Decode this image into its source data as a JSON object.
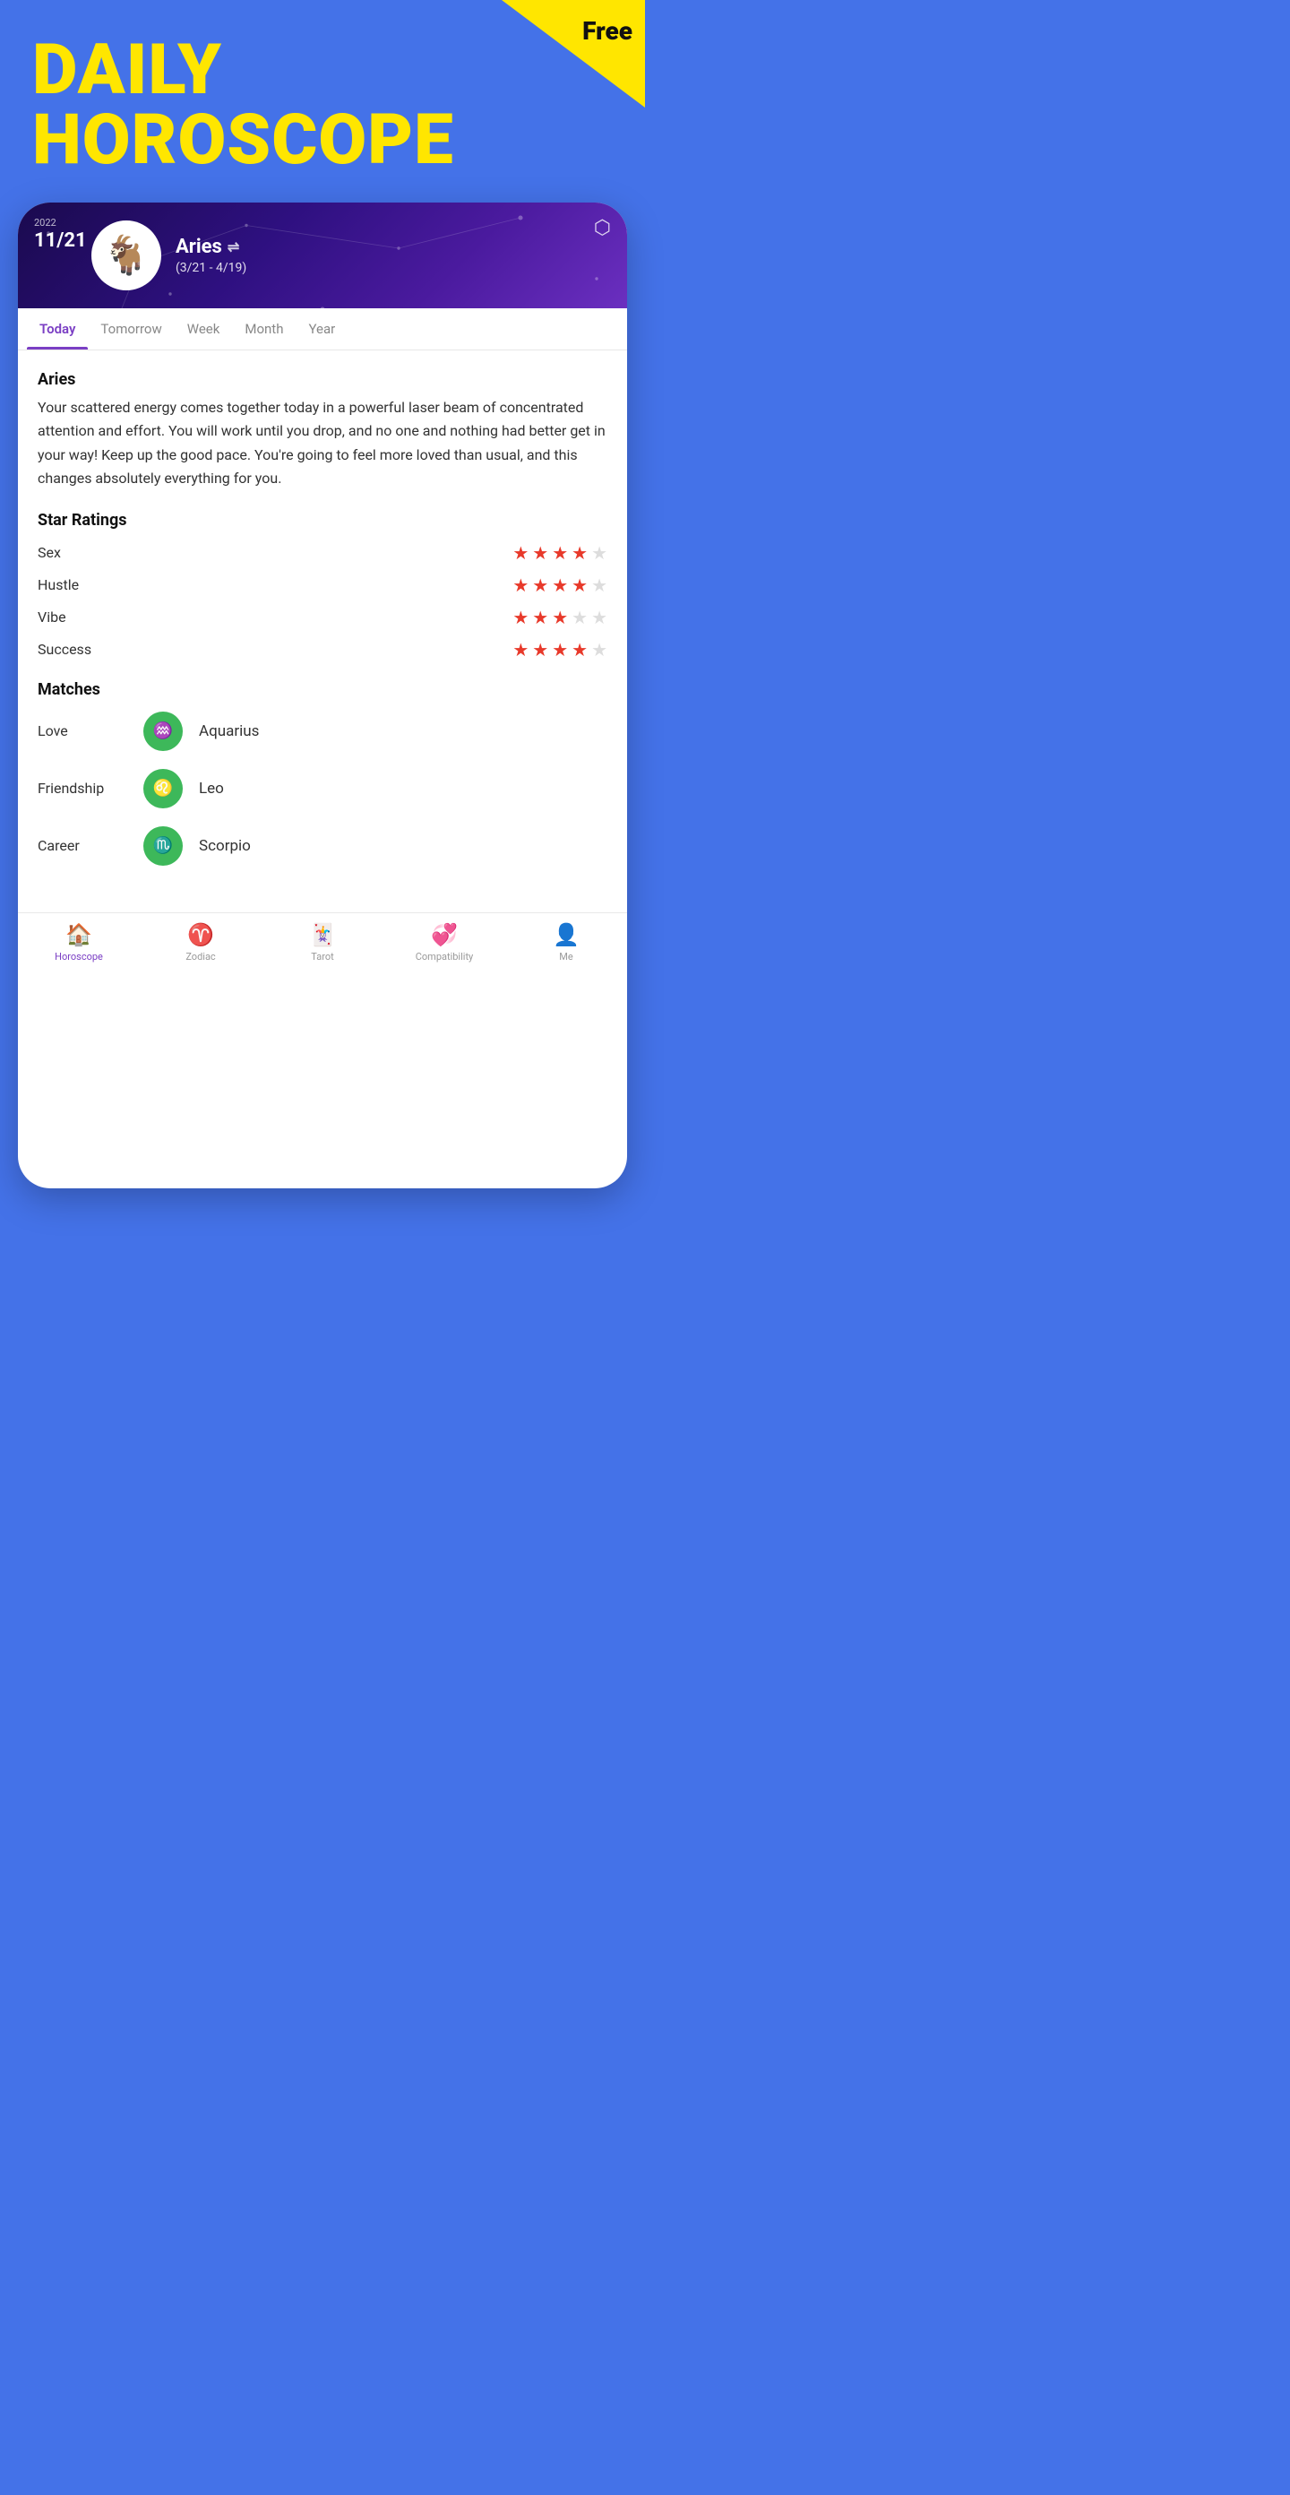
{
  "corner_badge": "Free",
  "app_title_line1": "DAILY",
  "app_title_line2": "HOROSCOPE",
  "header": {
    "year": "2022",
    "date": "11/21",
    "sign_name": "Aries",
    "sign_symbol": "♈",
    "sign_dates": "(3/21 - 4/19)",
    "sign_emoji": "🐐"
  },
  "tabs": [
    {
      "label": "Today",
      "active": true
    },
    {
      "label": "Tomorrow",
      "active": false
    },
    {
      "label": "Week",
      "active": false
    },
    {
      "label": "Month",
      "active": false
    },
    {
      "label": "Year",
      "active": false
    }
  ],
  "horoscope": {
    "sign": "Aries",
    "text": "Your scattered energy comes together today in a powerful laser beam of concentrated attention and effort. You will work until you drop, and no one and nothing had better get in your way! Keep up the good pace. You're going to feel more loved than usual, and this changes absolutely everything for you."
  },
  "star_ratings": {
    "title": "Star Ratings",
    "items": [
      {
        "label": "Sex",
        "filled": 4,
        "empty": 1
      },
      {
        "label": "Hustle",
        "filled": 4,
        "empty": 1
      },
      {
        "label": "Vibe",
        "filled": 3,
        "empty": 2
      },
      {
        "label": "Success",
        "filled": 4,
        "empty": 1
      }
    ]
  },
  "matches": {
    "title": "Matches",
    "items": [
      {
        "label": "Love",
        "sign": "Aquarius",
        "symbol": "♒"
      },
      {
        "label": "Friendship",
        "sign": "Leo",
        "symbol": "♌"
      },
      {
        "label": "Career",
        "sign": "Scorpio",
        "symbol": "♏"
      }
    ]
  },
  "bottom_nav": [
    {
      "label": "Horoscope",
      "icon": "🏠",
      "active": true
    },
    {
      "label": "Zodiac",
      "icon": "♈",
      "active": false
    },
    {
      "label": "Tarot",
      "icon": "🃏",
      "active": false
    },
    {
      "label": "Compatibility",
      "icon": "💞",
      "active": false
    },
    {
      "label": "Me",
      "icon": "👤",
      "active": false
    }
  ]
}
